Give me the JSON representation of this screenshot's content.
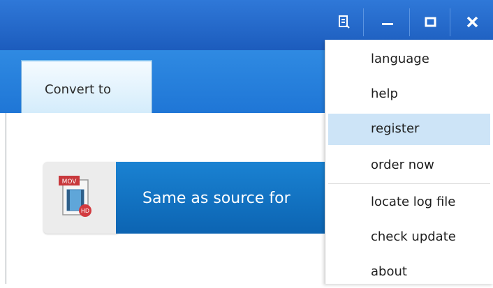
{
  "window": {
    "controls": {
      "log_icon": "log-icon",
      "minimize_icon": "minimize-icon",
      "maximize_icon": "maximize-icon",
      "close_icon": "close-icon"
    }
  },
  "tabs": [
    {
      "label": "Convert to",
      "active": true
    }
  ],
  "format": {
    "badge_text": "MOV",
    "hd_text": "HD",
    "label": "Same as source for "
  },
  "menu": {
    "items": [
      {
        "label": "language"
      },
      {
        "label": "help"
      },
      {
        "label": "register",
        "highlighted": true
      },
      {
        "label": "order now"
      },
      {
        "label": "locate log file"
      },
      {
        "label": "check update"
      },
      {
        "label": "about"
      }
    ]
  },
  "colors": {
    "titlebar": "#1c5cbd",
    "accent": "#0c64b2",
    "menu_highlight": "#cde4f7"
  }
}
